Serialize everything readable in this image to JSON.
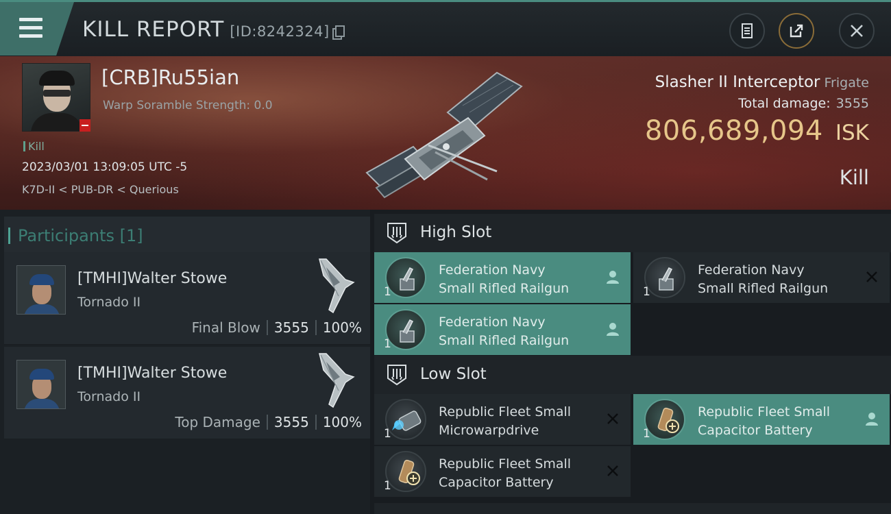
{
  "header": {
    "title": "KILL REPORT",
    "report_id": "[ID:8242324]",
    "buttons": [
      "notes-icon",
      "share-icon",
      "close-icon"
    ]
  },
  "victim": {
    "name": "[CRB]Ru55ian",
    "scramble": "Warp Soramble Strength: 0.0",
    "kill_tag": "Kill",
    "datetime": "2023/03/01 13:09:05 UTC -5",
    "location": "K7D-II < PUB-DR < Querious",
    "ship_name": "Slasher II Interceptor",
    "ship_class": "Frigate",
    "total_damage_label": "Total damage:",
    "total_damage": "3555",
    "isk_value": "806,689,094",
    "isk_unit": "ISK",
    "result": "Kill"
  },
  "participants": {
    "header": "Participants [1]",
    "cards": [
      {
        "name": "[TMHI]Walter Stowe",
        "ship": "Tornado II",
        "role": "Final Blow",
        "damage": "3555",
        "percent": "100%"
      },
      {
        "name": "[TMHI]Walter Stowe",
        "ship": "Tornado II",
        "role": "Top Damage",
        "damage": "3555",
        "percent": "100%"
      }
    ]
  },
  "fittings": {
    "high_slot": {
      "label": "High Slot",
      "modules": [
        {
          "line1": "Federation Navy",
          "line2": "Small Rifled Railgun",
          "qty": "1",
          "status": "dropped"
        },
        {
          "line1": "Federation Navy",
          "line2": "Small Rifled Railgun",
          "qty": "1",
          "status": "destroyed"
        },
        {
          "line1": "Federation Navy",
          "line2": "Small Rifled Railgun",
          "qty": "1",
          "status": "dropped"
        }
      ]
    },
    "low_slot": {
      "label": "Low Slot",
      "modules": [
        {
          "line1": "Republic Fleet Small",
          "line2": "Microwarpdrive",
          "qty": "1",
          "status": "destroyed"
        },
        {
          "line1": "Republic Fleet Small",
          "line2": "Capacitor Battery",
          "qty": "1",
          "status": "dropped"
        },
        {
          "line1": "Republic Fleet Small",
          "line2": "Capacitor Battery",
          "qty": "1",
          "status": "destroyed"
        }
      ]
    }
  },
  "colors": {
    "accent": "#4a8c80",
    "isk_gold": "#e6c68a",
    "banner_red": "#4a221f",
    "dropped_module": "#4a8c80"
  }
}
